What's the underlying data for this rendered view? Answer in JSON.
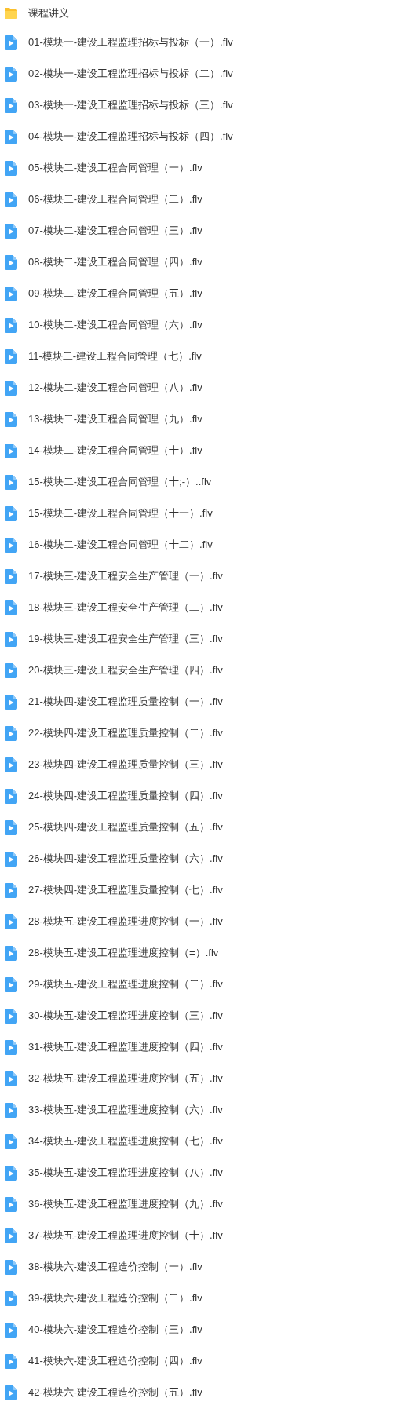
{
  "folder": {
    "name": "课程讲义"
  },
  "files": [
    {
      "name": "01-模块一-建设工程监理招标与投标（一）.flv"
    },
    {
      "name": "02-模块一-建设工程监理招标与投标（二）.flv"
    },
    {
      "name": "03-模块一-建设工程监理招标与投标（三）.flv"
    },
    {
      "name": "04-模块一-建设工程监理招标与投标（四）.flv"
    },
    {
      "name": "05-模块二-建设工程合同管理（一）.flv"
    },
    {
      "name": "06-模块二-建设工程合同管理（二）.flv"
    },
    {
      "name": "07-模块二-建设工程合同管理（三）.flv"
    },
    {
      "name": "08-模块二-建设工程合同管理（四）.flv"
    },
    {
      "name": "09-模块二-建设工程合同管理（五）.flv"
    },
    {
      "name": "10-模块二-建设工程合同管理（六）.flv"
    },
    {
      "name": "11-模块二-建设工程合同管理（七）.flv"
    },
    {
      "name": "12-模块二-建设工程合同管理（八）.flv"
    },
    {
      "name": "13-模块二-建设工程合同管理（九）.flv"
    },
    {
      "name": "14-模块二-建设工程合同管理（十）.flv"
    },
    {
      "name": "15-模块二-建设工程合同管理（十;-）..flv"
    },
    {
      "name": "15-模块二-建设工程合同管理（十一）.flv"
    },
    {
      "name": "16-模块二-建设工程合同管理（十二）.flv"
    },
    {
      "name": "17-模块三-建设工程安全生产管理（一）.flv"
    },
    {
      "name": "18-模块三-建设工程安全生产管理（二）.flv"
    },
    {
      "name": "19-模块三-建设工程安全生产管理（三）.flv"
    },
    {
      "name": "20-模块三-建设工程安全生产管理（四）.flv"
    },
    {
      "name": "21-模块四-建设工程监理质量控制（一）.flv"
    },
    {
      "name": "22-模块四-建设工程监理质量控制（二）.flv"
    },
    {
      "name": "23-模块四-建设工程监理质量控制（三）.flv"
    },
    {
      "name": "24-模块四-建设工程监理质量控制（四）.flv"
    },
    {
      "name": "25-模块四-建设工程监理质量控制（五）.flv"
    },
    {
      "name": "26-模块四-建设工程监理质量控制（六）.flv"
    },
    {
      "name": "27-模块四-建设工程监理质量控制（七）.flv"
    },
    {
      "name": "28-模块五-建设工程监理进度控制（一）.flv"
    },
    {
      "name": "28-模块五-建设工程监理进度控制（=）.flv"
    },
    {
      "name": "29-模块五-建设工程监理进度控制（二）.flv"
    },
    {
      "name": "30-模块五-建设工程监理进度控制（三）.flv"
    },
    {
      "name": "31-模块五-建设工程监理进度控制（四）.flv"
    },
    {
      "name": "32-模块五-建设工程监理进度控制（五）.flv"
    },
    {
      "name": "33-模块五-建设工程监理进度控制（六）.flv"
    },
    {
      "name": "34-模块五-建设工程监理进度控制（七）.flv"
    },
    {
      "name": "35-模块五-建设工程监理进度控制（八）.flv"
    },
    {
      "name": "36-模块五-建设工程监理进度控制（九）.flv"
    },
    {
      "name": "37-模块五-建设工程监理进度控制（十）.flv"
    },
    {
      "name": "38-模块六-建设工程造价控制（一）.flv"
    },
    {
      "name": "39-模块六-建设工程造价控制（二）.flv"
    },
    {
      "name": "40-模块六-建设工程造价控制（三）.flv"
    },
    {
      "name": "41-模块六-建设工程造价控制（四）.flv"
    },
    {
      "name": "42-模块六-建设工程造价控制（五）.flv"
    }
  ]
}
